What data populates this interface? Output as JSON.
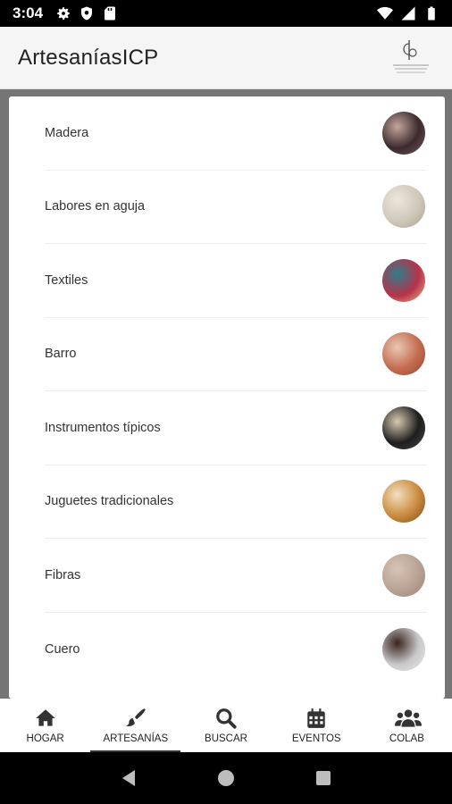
{
  "status_bar": {
    "time": "3:04",
    "left_icons": [
      "gear-icon",
      "shield-icon",
      "sd-card-icon"
    ],
    "right_icons": [
      "wifi-icon",
      "signal-icon",
      "battery-icon"
    ]
  },
  "app_bar": {
    "title": "ArtesaníasICP",
    "logo": "icp-logo"
  },
  "categories": [
    {
      "label": "Madera",
      "thumb_colors": [
        "#3a2a2e",
        "#c4a59a",
        "#7a5b63"
      ]
    },
    {
      "label": "Labores en aguja",
      "thumb_colors": [
        "#cfc7b9",
        "#ede6da",
        "#a89f90"
      ]
    },
    {
      "label": "Textiles",
      "thumb_colors": [
        "#b8324a",
        "#2f7d8a",
        "#e3c08a"
      ]
    },
    {
      "label": "Barro",
      "thumb_colors": [
        "#c46b4f",
        "#e9c7b3",
        "#8a4a36"
      ]
    },
    {
      "label": "Instrumentos típicos",
      "thumb_colors": [
        "#1e1e1e",
        "#d7c9b0",
        "#4a4a4a"
      ]
    },
    {
      "label": "Juguetes tradicionales",
      "thumb_colors": [
        "#c98a3c",
        "#f2dfc0",
        "#7a4c20"
      ]
    },
    {
      "label": "Fibras",
      "thumb_colors": [
        "#b9a293",
        "#d6c4b6",
        "#9a8474"
      ]
    },
    {
      "label": "Cuero",
      "thumb_colors": [
        "#c9c9c9",
        "#3a2320",
        "#e8e8e8"
      ]
    }
  ],
  "bottom_nav": [
    {
      "label": "HOGAR",
      "icon": "home-icon",
      "active": false
    },
    {
      "label": "ARTESANÍAS",
      "icon": "brush-icon",
      "active": true
    },
    {
      "label": "BUSCAR",
      "icon": "search-icon",
      "active": false
    },
    {
      "label": "EVENTOS",
      "icon": "calendar-icon",
      "active": false
    },
    {
      "label": "COLAB",
      "icon": "users-icon",
      "active": false
    }
  ],
  "system_nav": [
    "back-icon",
    "home-circle-icon",
    "recents-icon"
  ]
}
